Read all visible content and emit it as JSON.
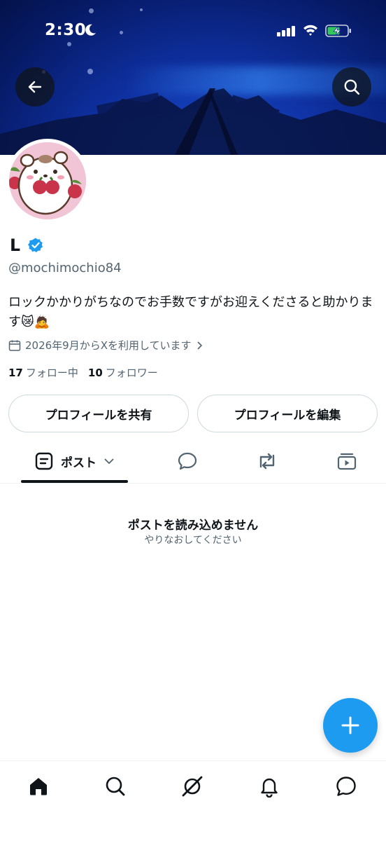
{
  "status_bar": {
    "time": "2:30"
  },
  "profile": {
    "display_name": "ᒪ",
    "handle": "@mochimochio84",
    "bio": "ロックかかりがちなのでお手数ですがお迎えくださると助かります😿🙇",
    "joined": "2026年9月からXを利用しています",
    "following_count": "17",
    "following_label": "フォロー中",
    "followers_count": "10",
    "followers_label": "フォロワー",
    "verified_color": "#1d9bf0"
  },
  "actions": {
    "share_label": "プロフィールを共有",
    "edit_label": "プロフィールを編集"
  },
  "tabs": {
    "posts_label": "ポスト",
    "icons": [
      "posts-icon",
      "replies-icon",
      "reposts-icon",
      "media-icon"
    ]
  },
  "empty_state": {
    "title": "ポストを読み込めません",
    "subtitle": "やりなおしてください"
  },
  "colors": {
    "accent": "#1d9bf0",
    "text": "#0f1419",
    "muted": "#536471"
  },
  "bottom_nav": [
    "home-icon",
    "search-icon",
    "grok-icon",
    "notifications-icon",
    "messages-icon"
  ]
}
